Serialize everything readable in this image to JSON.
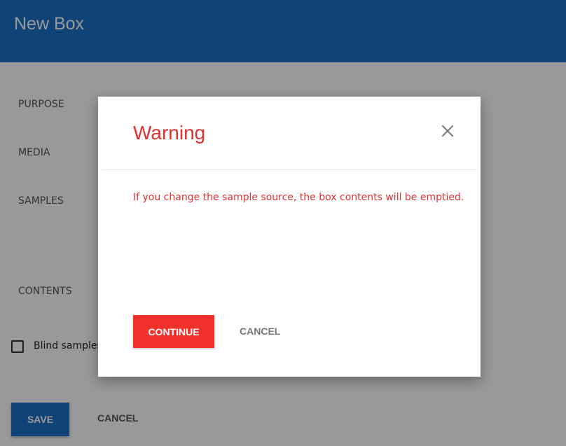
{
  "header": {
    "title": "New Box"
  },
  "form": {
    "labels": {
      "purpose": "PURPOSE",
      "media": "MEDIA",
      "samples": "SAMPLES",
      "contents": "CONTENTS"
    },
    "blind_samples_label": "Blind samples",
    "blind_samples_checked": false,
    "save_label": "SAVE",
    "cancel_label": "CANCEL"
  },
  "modal": {
    "title": "Warning",
    "message": "If you change the sample source, the box contents will be emptied.",
    "continue_label": "CONTINUE",
    "cancel_label": "CANCEL",
    "close_icon": "close-icon"
  },
  "colors": {
    "header_bg": "#1c71c7",
    "accent_red": "#e03131",
    "continue_bg": "#f0302a",
    "save_bg": "#1c71c7"
  }
}
